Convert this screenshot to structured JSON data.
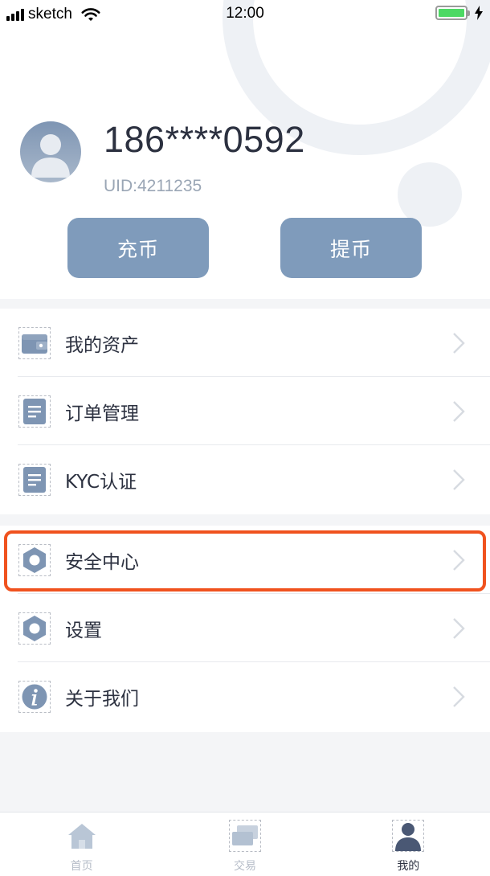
{
  "status_bar": {
    "carrier": "sketch",
    "time": "12:00"
  },
  "profile": {
    "phone": "186****0592",
    "uid": "UID:4211235"
  },
  "actions": {
    "deposit_label": "充币",
    "withdraw_label": "提币"
  },
  "menu_group_1": [
    {
      "label": "我的资产",
      "icon": "wallet-icon"
    },
    {
      "label": "订单管理",
      "icon": "document-icon"
    },
    {
      "label": "KYC认证",
      "icon": "document-icon"
    }
  ],
  "menu_group_2": [
    {
      "label": "安全中心",
      "icon": "hexagon-nut-icon"
    },
    {
      "label": "设置",
      "icon": "hexagon-nut-icon"
    },
    {
      "label": "关于我们",
      "icon": "info-icon"
    }
  ],
  "tabbar": {
    "items": [
      {
        "label": "首页",
        "icon": "home-icon",
        "active": false
      },
      {
        "label": "交易",
        "icon": "cards-icon",
        "active": false
      },
      {
        "label": "我的",
        "icon": "user-icon",
        "active": true
      }
    ]
  },
  "colors": {
    "accent": "#7f9bbb",
    "highlight": "#f0521e",
    "text_primary": "#2c3140",
    "battery": "#4cd964"
  }
}
